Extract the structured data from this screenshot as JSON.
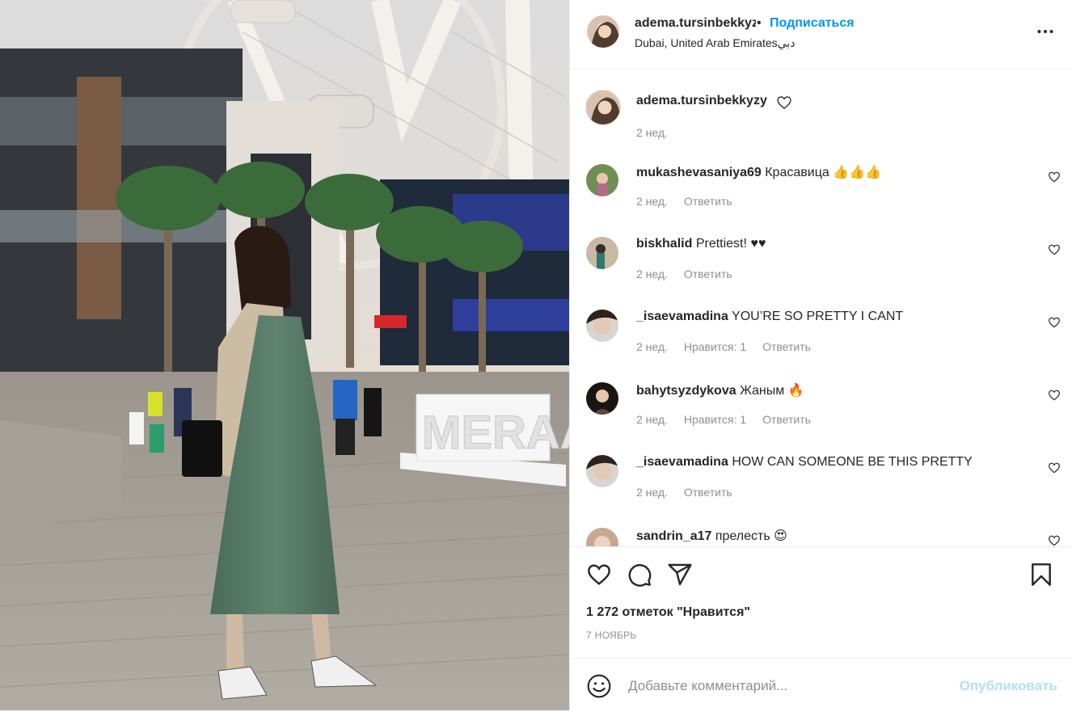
{
  "post": {
    "username": "adema.tursinbekkyzy",
    "dot": "•",
    "follow_label": "Подписаться",
    "location": "Dubai, United Arab Emiratesدبي",
    "image_sign": "MERAAS"
  },
  "caption": {
    "username": "adema.tursinbekkyzy",
    "time": "2 нед."
  },
  "comments": [
    {
      "user": "mukashevasaniya69",
      "text": "Красавица 👍👍👍",
      "time": "2 нед.",
      "likes": "",
      "reply": "Ответить"
    },
    {
      "user": "biskhalid",
      "text": "Prettiest! ♥♥",
      "time": "2 нед.",
      "likes": "",
      "reply": "Ответить"
    },
    {
      "user": "_isaevamadina",
      "text": "YOU’RE SO PRETTY I CANT",
      "time": "2 нед.",
      "likes": "Нравится: 1",
      "reply": "Ответить"
    },
    {
      "user": "bahytsyzdykova",
      "text": "Жаным 🔥",
      "time": "2 нед.",
      "likes": "Нравится: 1",
      "reply": "Ответить"
    },
    {
      "user": "_isaevamadina",
      "text": "HOW CAN SOMEONE BE THIS PRETTY",
      "time": "2 нед.",
      "likes": "",
      "reply": "Ответить"
    },
    {
      "user": "sandrin_a17",
      "text": "прелесть 😍",
      "time": "",
      "likes": "",
      "reply": ""
    }
  ],
  "actions": {
    "likes_text": "1 272 отметок \"Нравится\"",
    "date": "7 НОЯБРЬ"
  },
  "add_comment": {
    "placeholder": "Добавьте комментарий...",
    "post_label": "Опубликовать"
  },
  "icons": [
    "more-icon",
    "heart-icon",
    "comment-icon",
    "share-icon",
    "bookmark-icon",
    "emoji-icon"
  ],
  "colors": {
    "link": "#0095f6",
    "post_disabled": "#b2dffc",
    "muted": "#8e8e8e"
  }
}
